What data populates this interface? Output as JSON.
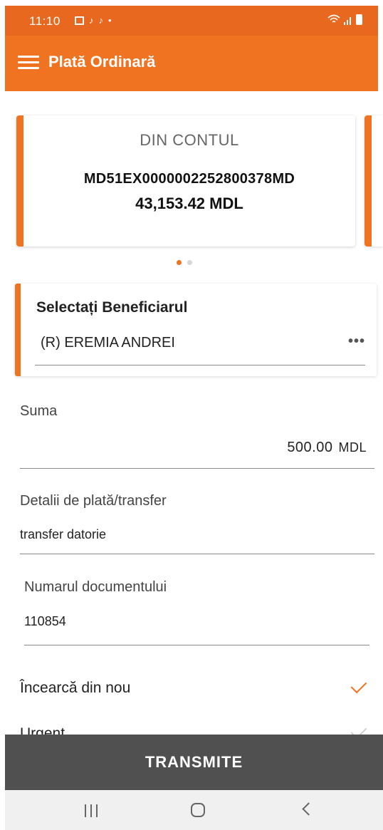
{
  "status_bar": {
    "time": "11:10",
    "icons": [
      "gallery-icon",
      "tiktok-icon",
      "tiktok-icon",
      "dot-icon"
    ],
    "right_icons": [
      "wifi-icon",
      "signal-icon",
      "battery-icon"
    ]
  },
  "app_bar": {
    "title": "Plată Ordinară",
    "menu_icon": "hamburger-menu-icon",
    "color": "#f07322"
  },
  "account_card": {
    "label": "DIN CONTUL",
    "iban": "MD51EX0000002252800378MD",
    "balance": "43,153.42 MDL",
    "page_index": 1,
    "page_count": 2
  },
  "beneficiary": {
    "title": "Selectați Beneficiarul",
    "value": "(R) EREMIA ANDREI",
    "more_icon": "more-horizontal-icon",
    "more_label": "•••"
  },
  "amount": {
    "label": "Suma",
    "value": "500.00",
    "currency": "MDL"
  },
  "details": {
    "label": "Detalii de plată/transfer",
    "value": "transfer datorie"
  },
  "document": {
    "label": "Numarul documentului",
    "value": "110854"
  },
  "options": [
    {
      "label": "Încearcă din nou",
      "checked": true
    },
    {
      "label": "Urgent",
      "checked": false
    }
  ],
  "submit": {
    "label": "TRANSMITE",
    "color": "#505050"
  },
  "nav_bar": {
    "icons": [
      "recents-icon",
      "home-icon",
      "back-icon"
    ]
  }
}
